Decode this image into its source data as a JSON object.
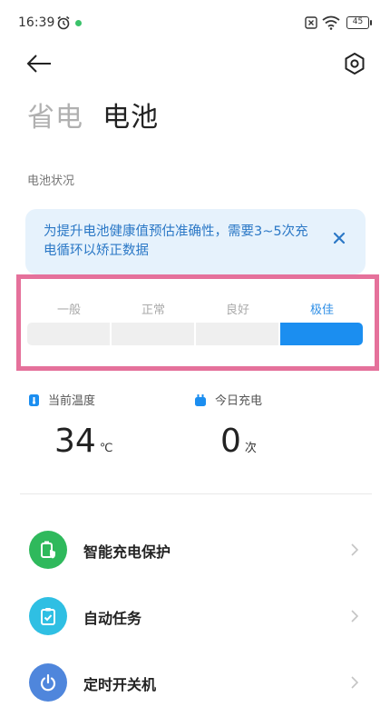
{
  "status_bar": {
    "time": "16:39",
    "battery": "45"
  },
  "title": {
    "tab_inactive": "省电",
    "tab_active": "电池"
  },
  "section": {
    "label": "电池状况"
  },
  "tip": {
    "text": "为提升电池健康值预估准确性，需要3~5次充电循环以矫正数据"
  },
  "health": {
    "levels": [
      "一般",
      "正常",
      "良好",
      "极佳"
    ],
    "current": "极佳",
    "accent_color": "#1b8ef0"
  },
  "stats": {
    "temperature": {
      "label": "当前温度",
      "value": "34",
      "unit": "℃"
    },
    "charges": {
      "label": "今日充电",
      "value": "0",
      "unit": "次"
    }
  },
  "menu": [
    {
      "label": "智能充电保护",
      "icon": "battery-shield-icon",
      "color": "#2fb95c"
    },
    {
      "label": "自动任务",
      "icon": "clipboard-check-icon",
      "color": "#2fbfe3"
    },
    {
      "label": "定时开关机",
      "icon": "power-icon",
      "color": "#4f86dc"
    }
  ]
}
